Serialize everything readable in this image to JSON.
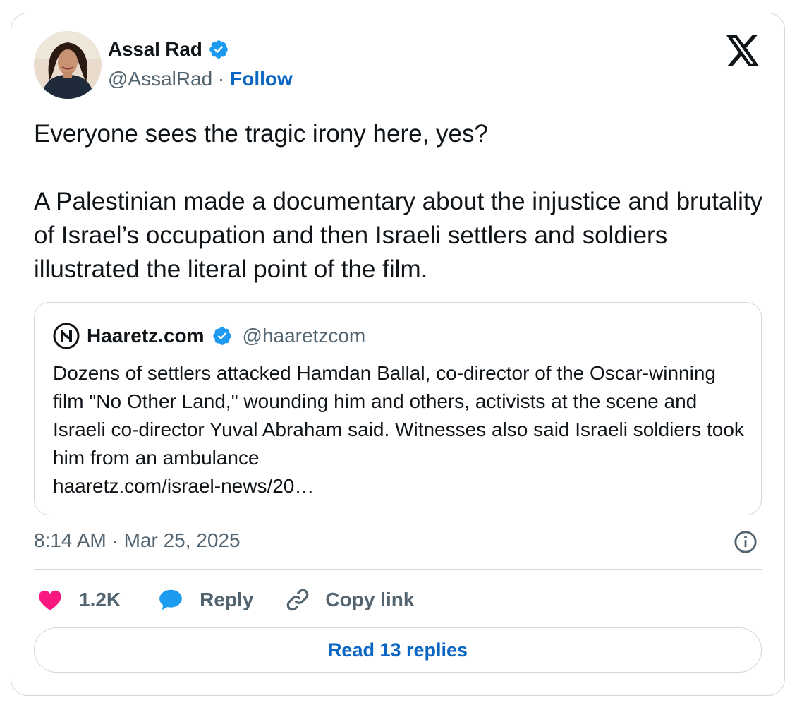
{
  "author": {
    "name": "Assal Rad",
    "handle": "@AssalRad",
    "separator": "·",
    "follow_label": "Follow"
  },
  "tweet": {
    "paragraphs": [
      "Everyone sees the tragic irony here, yes?",
      "A Palestinian made a documentary about the injustice and brutality of Israel’s occupation and then Israeli settlers and soldiers illustrated the literal point of the film."
    ]
  },
  "quote": {
    "name": "Haaretz.com",
    "handle": "@haaretzcom",
    "text": "Dozens of settlers attacked Hamdan Ballal, co-director of the Oscar-winning film \"No Other Land,\" wounding him and others, activists at the scene and Israeli co-director Yuval Abraham said. Witnesses also said Israeli soldiers took him from an ambulance",
    "link": "haaretz.com/israel-news/20…"
  },
  "timestamp": "8:14 AM · Mar 25, 2025",
  "actions": {
    "likes": "1.2K",
    "reply_label": "Reply",
    "copy_label": "Copy link"
  },
  "read_replies_label": "Read 13 replies",
  "icons": {
    "verified": "verified-badge-icon",
    "x_logo": "x-logo-icon",
    "like": "heart-icon",
    "reply": "speech-bubble-icon",
    "copy": "link-icon",
    "info": "info-icon"
  },
  "colors": {
    "link_blue": "#0a66c2",
    "verified_blue": "#1d9bf0",
    "heart_pink": "#f91880",
    "secondary_text": "#536471",
    "border": "#cfd9de"
  }
}
